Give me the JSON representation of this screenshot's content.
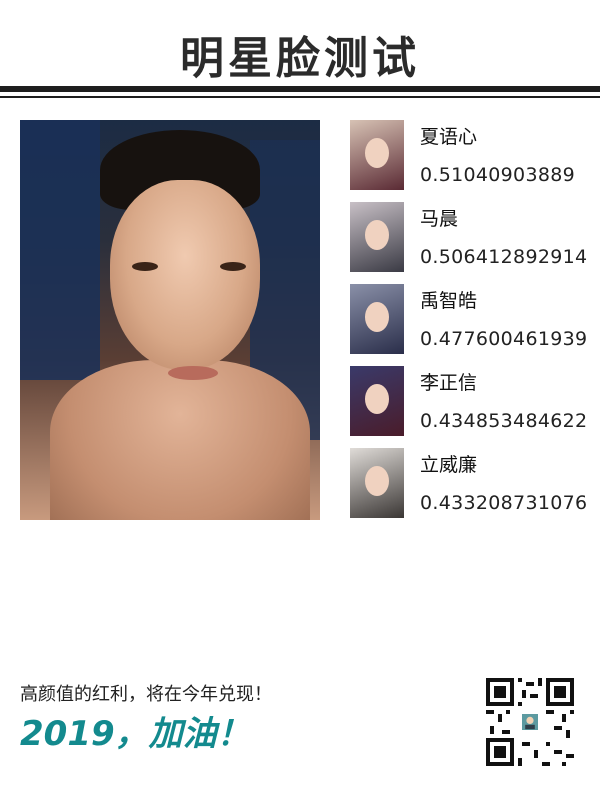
{
  "header": {
    "title": "明星脸测试"
  },
  "matches": [
    {
      "name": "夏语心",
      "score": "0.51040903889",
      "thumb_color": "#5a2a34"
    },
    {
      "name": "马晨",
      "score": "0.506412892914",
      "thumb_color": "#3a3a44"
    },
    {
      "name": "禹智皓",
      "score": "0.477600461939",
      "thumb_color": "#2a2e4a"
    },
    {
      "name": "李正信",
      "score": "0.434853484622",
      "thumb_color": "#4a1c2a"
    },
    {
      "name": "立威廉",
      "score": "0.433208731076",
      "thumb_color": "#3a3634"
    }
  ],
  "footer": {
    "slogan": "高颜值的红利，将在今年兑现！",
    "cheer": "2019，加油！",
    "accent_color": "#138a8e"
  },
  "icons": {
    "qr": "qr-code-icon"
  }
}
